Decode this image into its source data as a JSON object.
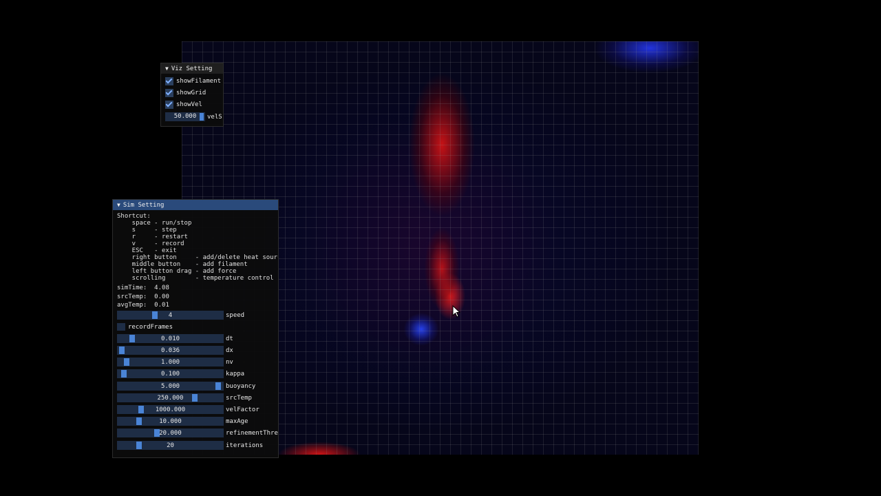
{
  "viz_panel": {
    "title": "Viz Setting",
    "checkboxes": [
      {
        "label": "showFilament",
        "checked": true
      },
      {
        "label": "showGrid",
        "checked": true
      },
      {
        "label": "showVel",
        "checked": true
      }
    ],
    "vel_scale": {
      "value": "50.000",
      "label": "velS"
    }
  },
  "sim_panel": {
    "title": "Sim Setting",
    "shortcuts": [
      "Shortcut:",
      "    space - run/stop",
      "    s     - step",
      "    r     - restart",
      "    v     - record",
      "    ESC   - exit",
      "    right button     - add/delete heat sourc",
      "    middle button    - add filament",
      "    left button drag - add force",
      "    scrolling        - temperature control"
    ],
    "stats": [
      "simTime:  4.08",
      "srcTemp:  0.00",
      "avgTemp:  0.01"
    ],
    "speed": {
      "value": "4",
      "label": "speed",
      "fraction": 0.35
    },
    "record_frames": {
      "label": "recordFrames",
      "checked": false
    },
    "sliders": [
      {
        "value": "0.010",
        "label": "dt",
        "fraction": 0.12
      },
      {
        "value": "0.036",
        "label": "dx",
        "fraction": 0.02
      },
      {
        "value": "1.000",
        "label": "nv",
        "fraction": 0.07
      },
      {
        "value": "0.100",
        "label": "kappa",
        "fraction": 0.04
      },
      {
        "value": "5.000",
        "label": "buoyancy",
        "fraction": 0.97
      },
      {
        "value": "250.000",
        "label": "srcTemp",
        "fraction": 0.74
      },
      {
        "value": "1000.000",
        "label": "velFactor",
        "fraction": 0.21
      },
      {
        "value": "10.000",
        "label": "maxAge",
        "fraction": 0.19
      },
      {
        "value": "20.000",
        "label": "refinementThre",
        "fraction": 0.37
      },
      {
        "value": "20",
        "label": "iterations",
        "fraction": 0.19
      }
    ]
  },
  "colors": {
    "accent": "#4a84d6",
    "title_active": "#2a4a7b",
    "frame_bg": "#1e2d45",
    "hot": "#e61414",
    "cold": "#2846ff"
  }
}
